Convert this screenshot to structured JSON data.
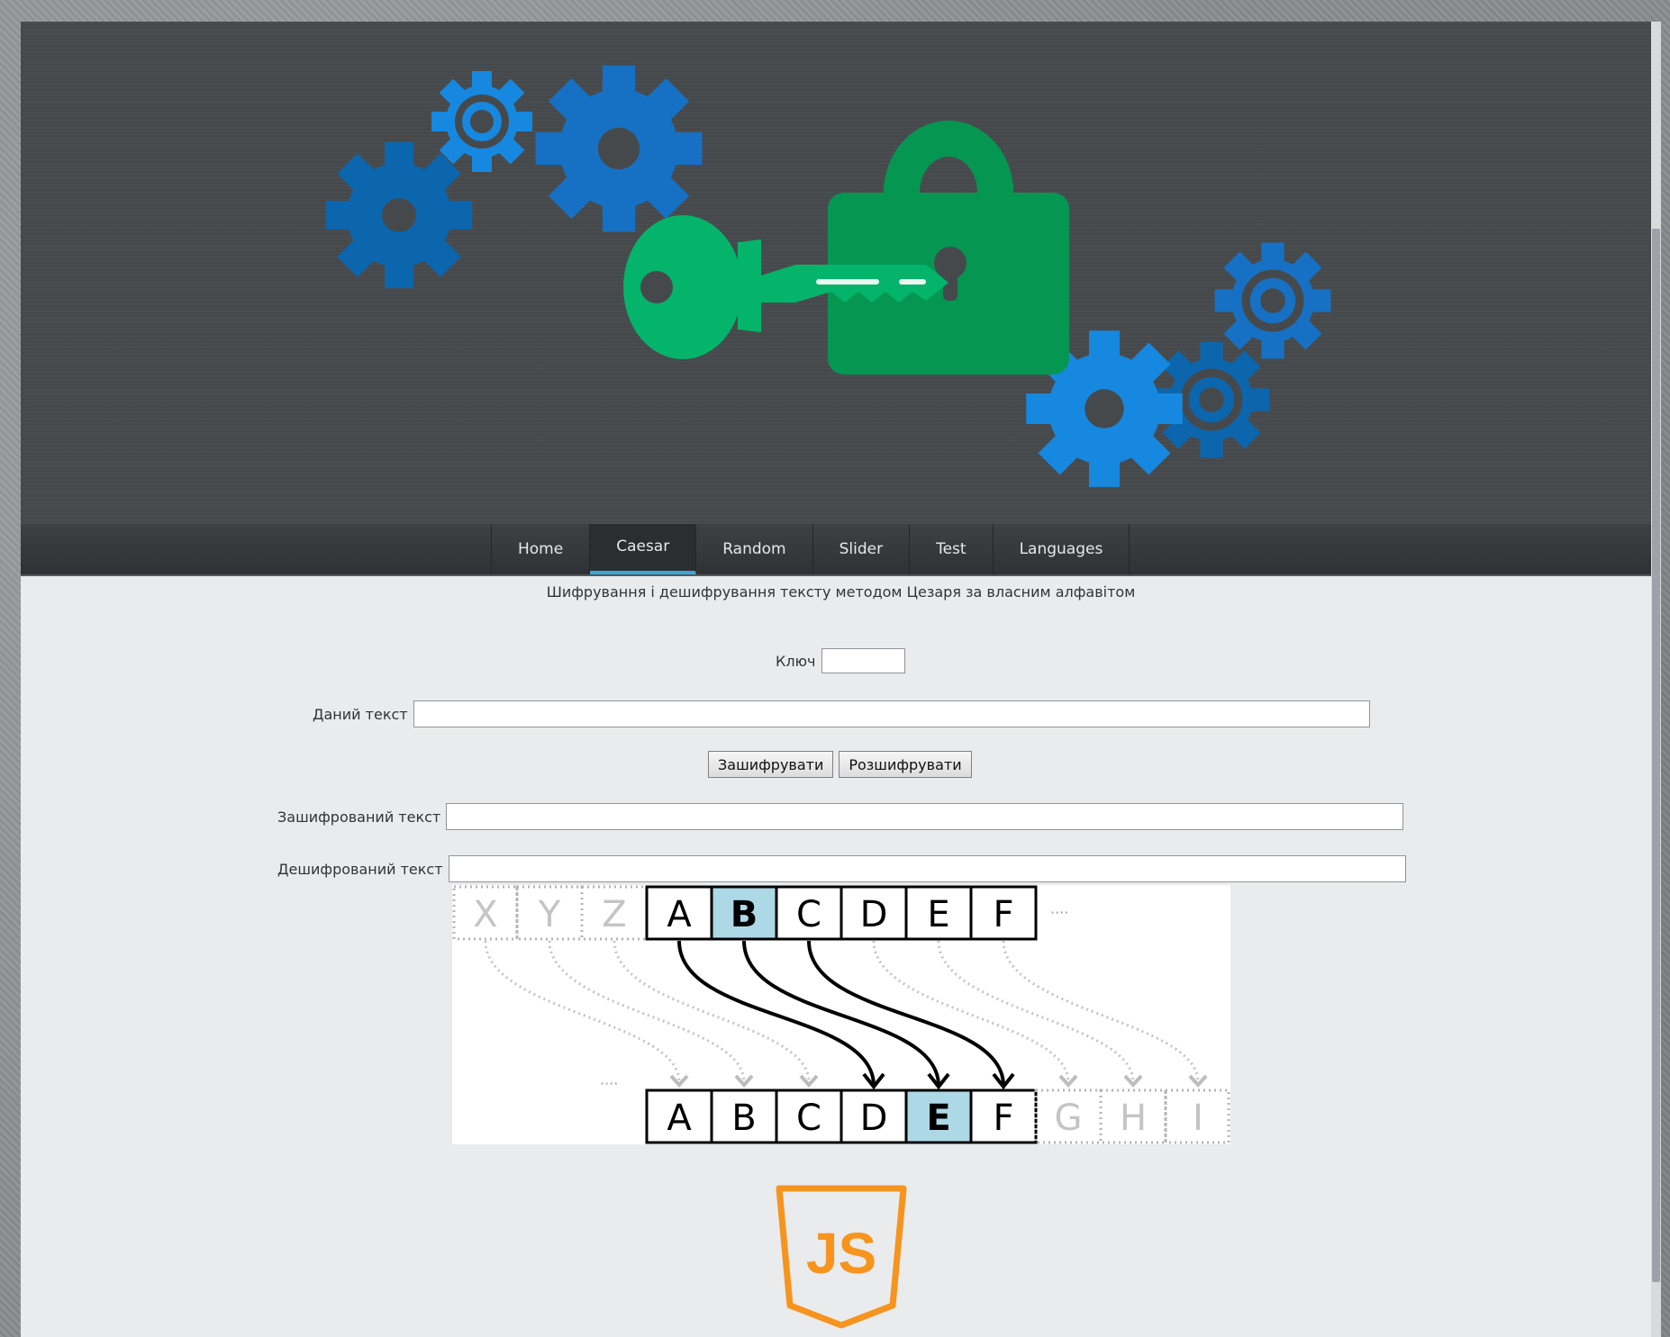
{
  "nav": {
    "items": [
      {
        "label": "Home",
        "active": false
      },
      {
        "label": "Caesar",
        "active": true
      },
      {
        "label": "Random",
        "active": false
      },
      {
        "label": "Slider",
        "active": false
      },
      {
        "label": "Test",
        "active": false
      },
      {
        "label": "Languages",
        "active": false
      }
    ]
  },
  "main": {
    "subtitle": "Шифрування і дешифрування тексту методом Цезаря за власним алфавітом",
    "key": {
      "label": "Ключ",
      "value": ""
    },
    "input_text": {
      "label": "Даний текст",
      "value": ""
    },
    "buttons": {
      "encrypt": "Зашифрувати",
      "decrypt": "Розшифрувати"
    },
    "encrypted_text": {
      "label": "Зашифрований текст",
      "value": ""
    },
    "decrypted_text": {
      "label": "Дешифрований текст",
      "value": ""
    }
  },
  "diagram": {
    "top_faded": [
      "X",
      "Y",
      "Z"
    ],
    "top_letters": [
      "A",
      "B",
      "C",
      "D",
      "E",
      "F"
    ],
    "top_highlight": "B",
    "bottom_letters": [
      "A",
      "B",
      "C",
      "D",
      "E",
      "F"
    ],
    "bottom_faded": [
      "G",
      "H",
      "I"
    ],
    "bottom_highlight": "E",
    "ellipsis": "····"
  },
  "logo": {
    "text": "JS"
  },
  "colors": {
    "banner_bg": "#46494c",
    "gear_blue_dark": "#0b66ad",
    "gear_blue": "#1688df",
    "lock_green": "#059652",
    "key_green": "#04b46a",
    "nav_active": "#3ba4d8",
    "highlight_cell": "#add8e6",
    "js_orange": "#f7941d"
  }
}
